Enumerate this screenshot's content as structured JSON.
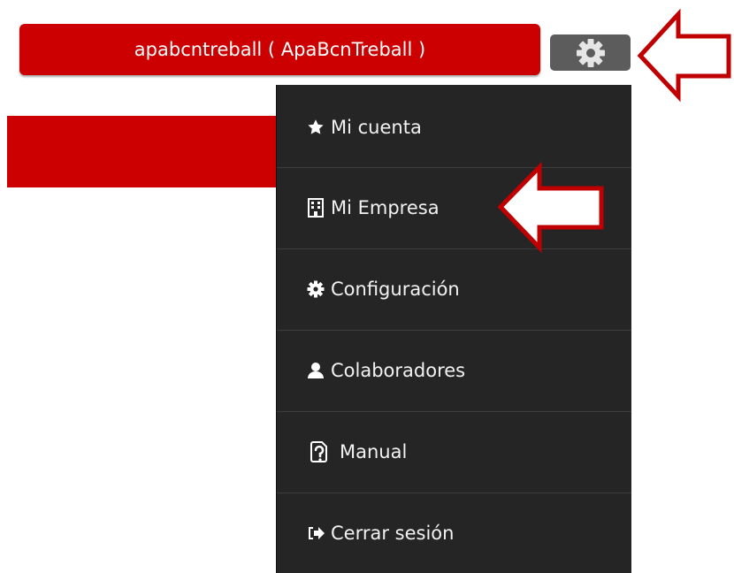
{
  "header": {
    "user_label": "apabcntreball ( ApaBcnTreball )",
    "settings_icon": "gear-icon"
  },
  "menu": {
    "items": [
      {
        "label": "Mi cuenta",
        "icon": "star-icon"
      },
      {
        "label": "Mi Empresa",
        "icon": "building-icon"
      },
      {
        "label": "Configuración",
        "icon": "cog-icon"
      },
      {
        "label": "Colaboradores",
        "icon": "user-icon"
      },
      {
        "label": "Manual",
        "icon": "help-document-icon"
      },
      {
        "label": "Cerrar sesión",
        "icon": "sign-out-icon"
      }
    ]
  },
  "colors": {
    "brand_red": "#cc0000",
    "menu_background": "#252525",
    "gear_button": "#5c5c5c",
    "annotation_arrow_fill": "#ffffff",
    "annotation_arrow_stroke": "#c00000"
  }
}
